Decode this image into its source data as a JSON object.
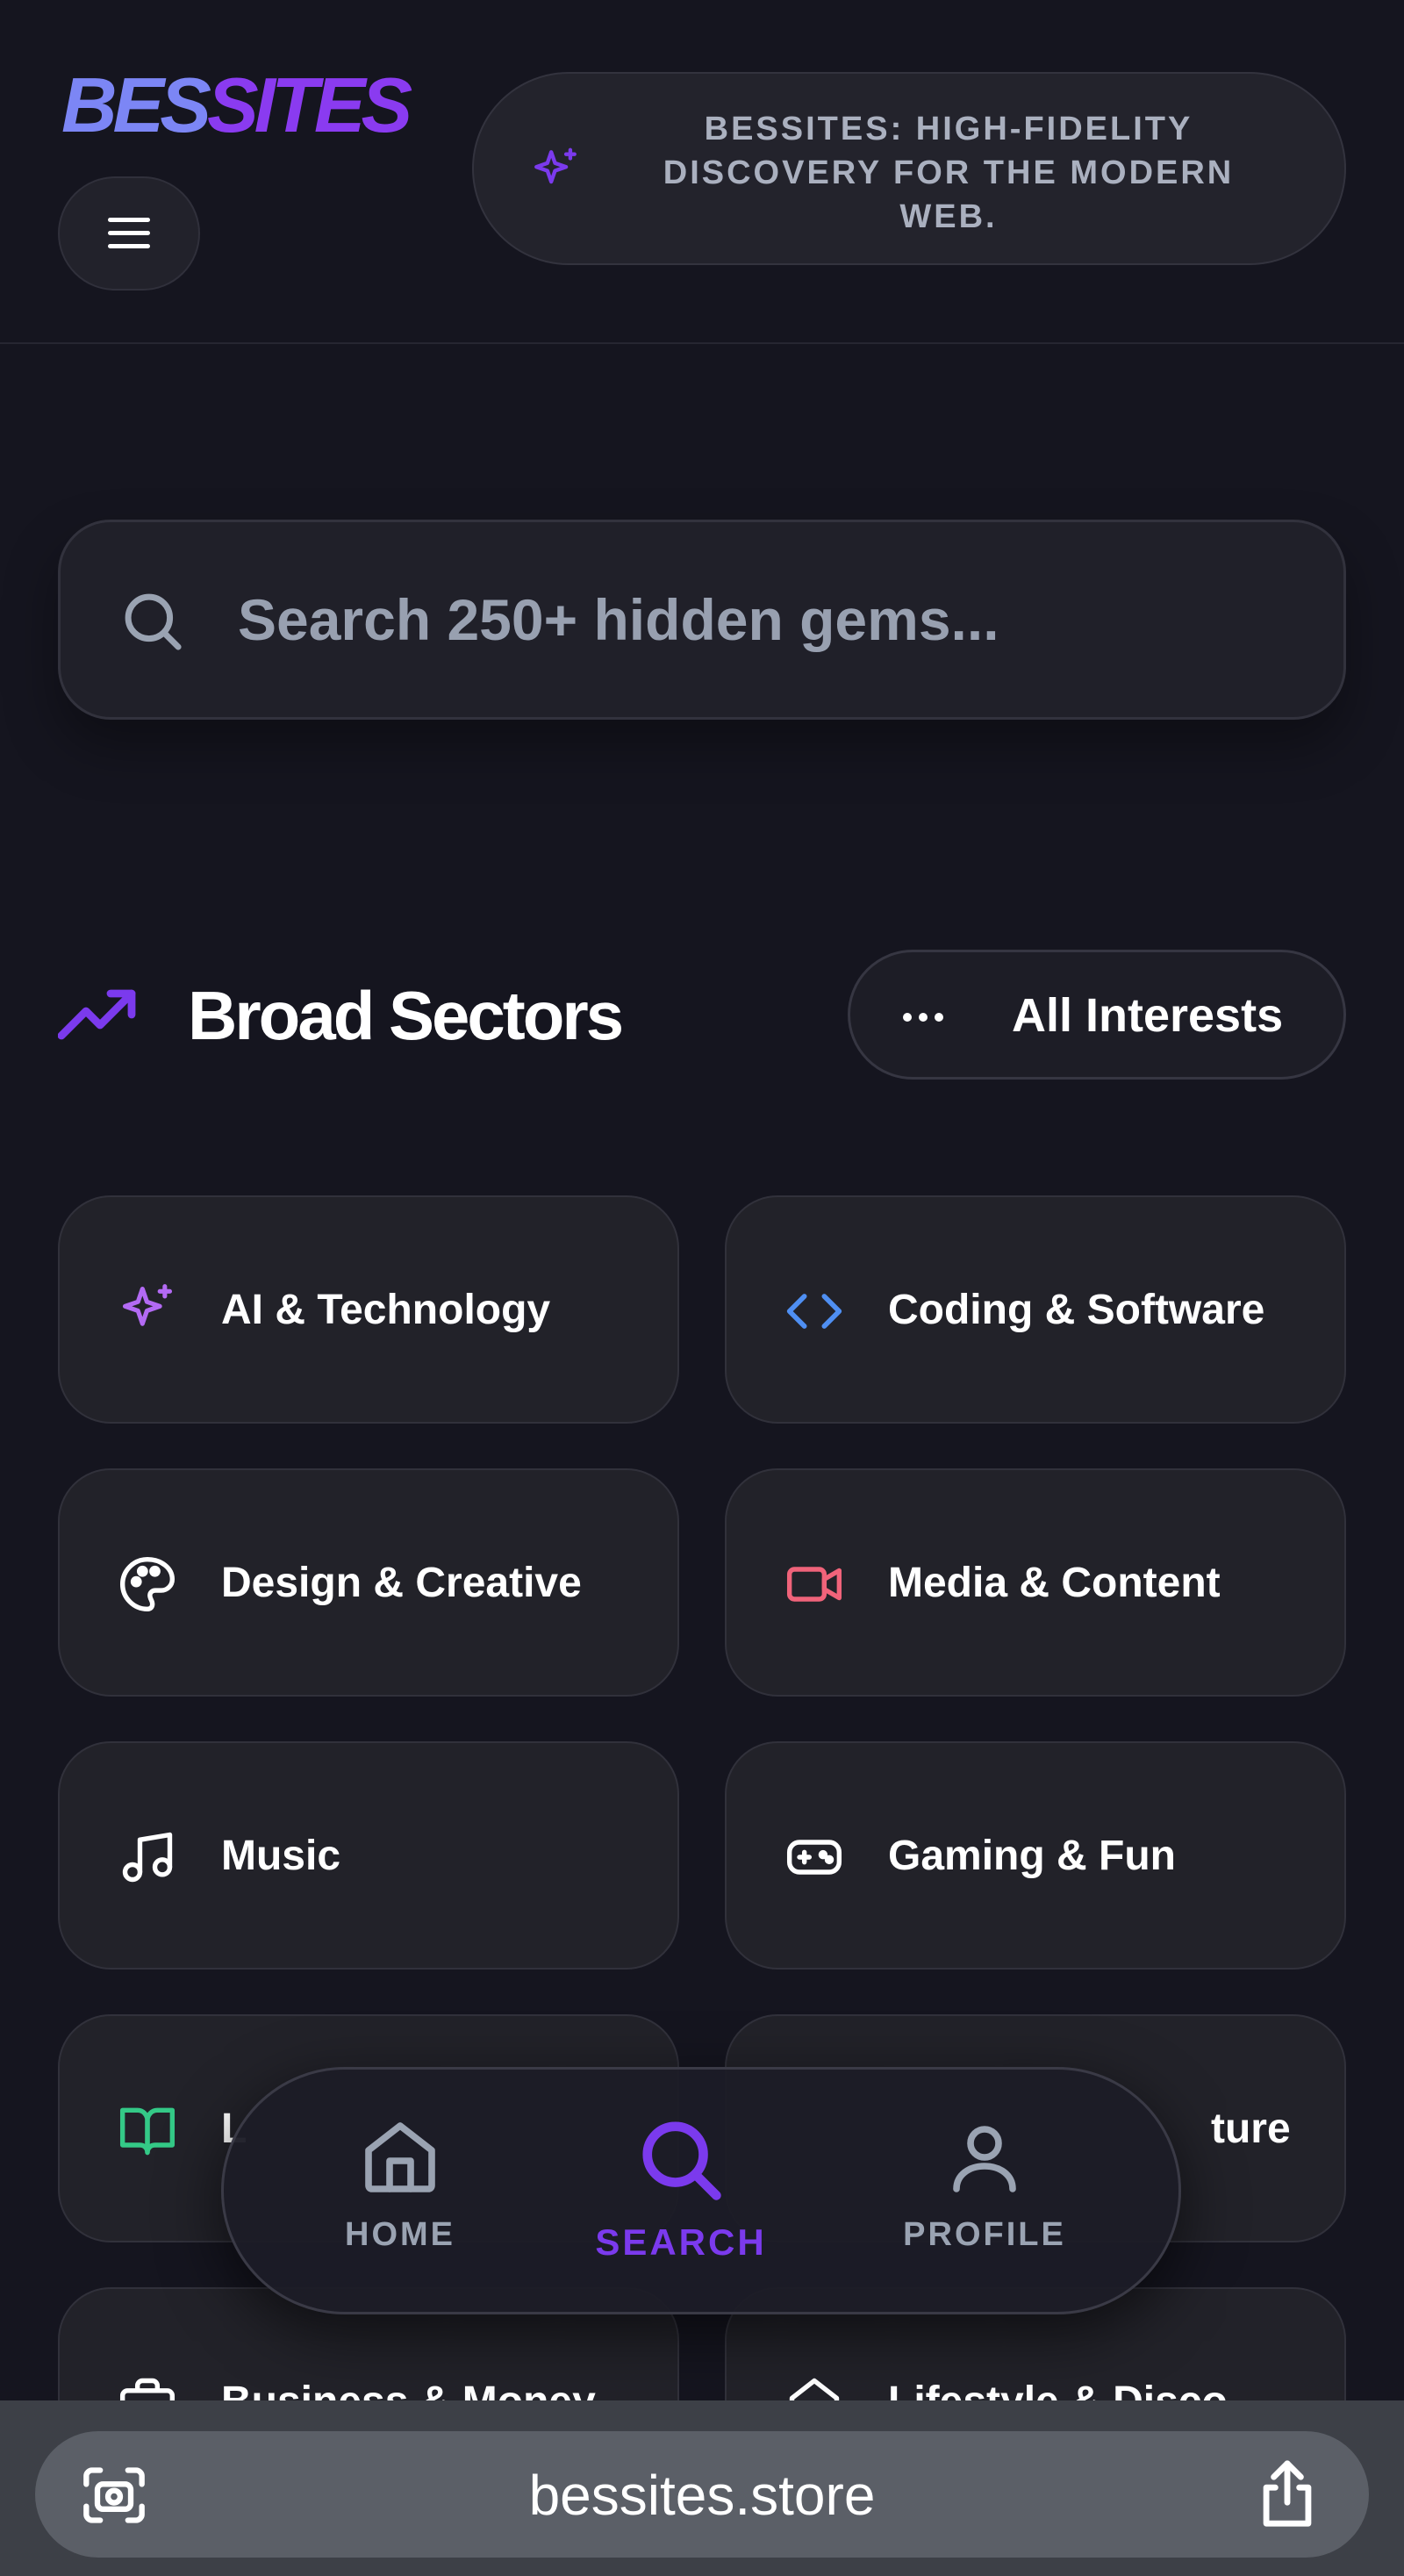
{
  "header": {
    "logo_part1": "BES",
    "logo_part2": "SITES",
    "menu_icon": "hamburger-icon",
    "tagline": "BESSITES: HIGH-FIDELITY DISCOVERY FOR THE MODERN WEB.",
    "tagline_icon": "sparkles-icon"
  },
  "search": {
    "placeholder": "Search 250+ hidden gems...",
    "value": "",
    "icon": "search-icon"
  },
  "section": {
    "icon": "trending-up-icon",
    "title": "Broad Sectors",
    "all_button_icon": "more-horizontal-icon",
    "all_button_label": "All Interests"
  },
  "sectors": [
    {
      "label": "AI & Technology",
      "icon": "sparkles-icon",
      "color": "#b36af4"
    },
    {
      "label": "Coding & Software",
      "icon": "code-icon",
      "color": "#4f8ff2"
    },
    {
      "label": "Design & Creative",
      "icon": "palette-icon",
      "color": "#ffffff"
    },
    {
      "label": "Media & Content",
      "icon": "video-icon",
      "color": "#f0637a"
    },
    {
      "label": "Music",
      "icon": "music-icon",
      "color": "#ffffff"
    },
    {
      "label": "Gaming & Fun",
      "icon": "gamepad-icon",
      "color": "#ffffff"
    },
    {
      "label": "L",
      "icon": "book-open-icon",
      "color": "#34c987"
    },
    {
      "label": "ture",
      "icon": "",
      "color": "#ffffff"
    },
    {
      "label": "Business & Money",
      "icon": "briefcase-icon",
      "color": "#ffffff"
    },
    {
      "label": "Lifestyle & Disco",
      "icon": "home-icon",
      "color": "#ffffff"
    }
  ],
  "bottom_nav": [
    {
      "label": "HOME",
      "icon": "home-icon",
      "active": false
    },
    {
      "label": "SEARCH",
      "icon": "search-icon",
      "active": true
    },
    {
      "label": "PROFILE",
      "icon": "user-icon",
      "active": false
    }
  ],
  "browser": {
    "url": "bessites.store",
    "left_icon": "camera-icon",
    "right_icon": "share-icon"
  },
  "colors": {
    "background": "#15151f",
    "accent": "#7b3aed",
    "logo_blue": "#7c86f5",
    "logo_purple": "#8a3bf0"
  }
}
